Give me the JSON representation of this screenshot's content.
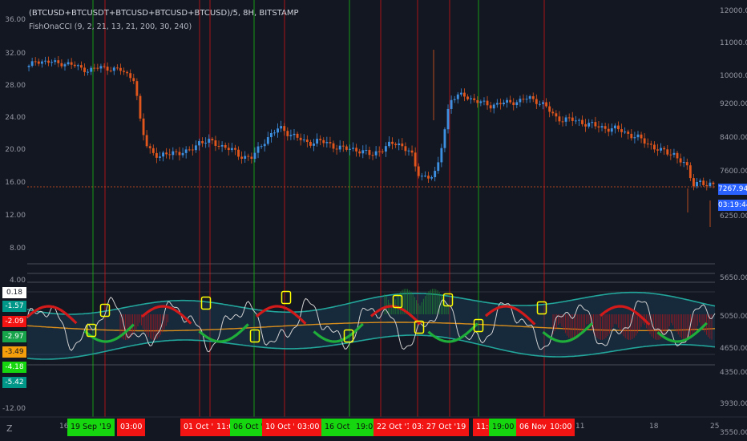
{
  "header": {
    "title": "(BTCUSD+BTCUSDT+BTCUSD+BTCUSD+BTCUSD)/5, 8H, BITSTAMP",
    "indicator": "FishOnaCCI (9, 2, 21, 13, 21, 200, 30, 240)"
  },
  "left_axis": [
    "36.00",
    "32.00",
    "28.00",
    "24.00",
    "20.00",
    "16.00",
    "12.00",
    "8.00",
    "4.00",
    "-12.00"
  ],
  "right_axis": [
    "12000.00",
    "11000.00",
    "10000.00",
    "9200.00",
    "8400.00",
    "7600.00",
    "6250.00",
    "5650.00",
    "5050.00",
    "4650.00",
    "4350.00",
    "3930.00",
    "3550.00"
  ],
  "price_badges": {
    "last": "7267.94",
    "timer": "03:19:44"
  },
  "indicator_badges": [
    {
      "text": "0.18",
      "bg": "#ffffff",
      "fg": "#131722"
    },
    {
      "text": "-1.57",
      "bg": "#009688",
      "fg": "#ffffff"
    },
    {
      "text": "-2.09",
      "bg": "#f21313",
      "fg": "#ffffff"
    },
    {
      "text": "-2.97",
      "bg": "#16a34a",
      "fg": "#ffffff"
    },
    {
      "text": "-3.49",
      "bg": "#f59e0b",
      "fg": "#131722"
    },
    {
      "text": "-4.18",
      "bg": "#16d70f",
      "fg": "#ffffff"
    },
    {
      "text": "-5.42",
      "bg": "#009688",
      "fg": "#ffffff"
    }
  ],
  "x_tags": [
    {
      "text": "19 Sep '19",
      "type": "g"
    },
    {
      "text": "03:00",
      "type": "r"
    },
    {
      "text": "01 Oct '19",
      "type": "r"
    },
    {
      "text": "11:00",
      "type": "r"
    },
    {
      "text": "06 Oct '19",
      "type": "g"
    },
    {
      "text": "10 Oct '19",
      "type": "r"
    },
    {
      "text": "03:00",
      "type": "r"
    },
    {
      "text": "16 Oct '19",
      "type": "g"
    },
    {
      "text": "19:00",
      "type": "g"
    },
    {
      "text": "22 Oct '19",
      "type": "r"
    },
    {
      "text": "03:00",
      "type": "r"
    },
    {
      "text": "27 Oct '19",
      "type": "r"
    },
    {
      "text": "11:00",
      "type": "r"
    },
    {
      "text": "19:00",
      "type": "g"
    },
    {
      "text": "06 Nov '19",
      "type": "r"
    },
    {
      "text": "10:00",
      "type": "r"
    }
  ],
  "x_ticks": [
    "16",
    "11",
    "18",
    "25"
  ],
  "icons": {
    "zoom": "Z"
  },
  "colors": {
    "background": "#131722",
    "bull": "#3d8fe0",
    "bear": "#e0561c",
    "buy_line": "#16d70f",
    "sell_line": "#f21313",
    "fish": "#d0d0d0",
    "band": "#22a59a",
    "signal": "#d98e1c"
  },
  "chart_data": {
    "type": "candlestick",
    "symbol": "(BTCUSD+BTCUSDT+BTCUSD+BTCUSD+BTCUSD)/5",
    "timeframe": "8H",
    "exchange": "BITSTAMP",
    "price_axis": {
      "min": 3550,
      "max": 12000,
      "ticks": [
        12000,
        11000,
        10000,
        9200,
        8400,
        7600,
        6250,
        5650,
        5050,
        4650,
        4350,
        3930,
        3550
      ]
    },
    "last_price": 7267.94,
    "price_path": [
      [
        0,
        10300
      ],
      [
        1,
        10500
      ],
      [
        3,
        10450
      ],
      [
        6,
        10400
      ],
      [
        9,
        10200
      ],
      [
        11,
        10300
      ],
      [
        14,
        10200
      ],
      [
        16,
        9950
      ],
      [
        17,
        8700
      ],
      [
        18,
        8200
      ],
      [
        20,
        7950
      ],
      [
        22,
        8100
      ],
      [
        24,
        8050
      ],
      [
        26,
        8350
      ],
      [
        28,
        8300
      ],
      [
        30,
        8200
      ],
      [
        32,
        8000
      ],
      [
        34,
        7950
      ],
      [
        36,
        8400
      ],
      [
        38,
        8650
      ],
      [
        40,
        8500
      ],
      [
        42,
        8300
      ],
      [
        44,
        8350
      ],
      [
        46,
        8250
      ],
      [
        48,
        8150
      ],
      [
        50,
        8150
      ],
      [
        52,
        8000
      ],
      [
        54,
        8200
      ],
      [
        56,
        8300
      ],
      [
        58,
        8100
      ],
      [
        59,
        7550
      ],
      [
        61,
        7450
      ],
      [
        62,
        7600
      ],
      [
        63,
        8500
      ],
      [
        64,
        9350
      ],
      [
        66,
        9500
      ],
      [
        68,
        9300
      ],
      [
        70,
        9200
      ],
      [
        72,
        9250
      ],
      [
        74,
        9300
      ],
      [
        76,
        9400
      ],
      [
        78,
        9250
      ],
      [
        80,
        8900
      ],
      [
        82,
        8850
      ],
      [
        84,
        8800
      ],
      [
        86,
        8700
      ],
      [
        88,
        8650
      ],
      [
        90,
        8600
      ],
      [
        92,
        8450
      ],
      [
        94,
        8300
      ],
      [
        96,
        8100
      ],
      [
        98,
        8050
      ],
      [
        100,
        7700
      ],
      [
        101,
        7250
      ],
      [
        102,
        7350
      ],
      [
        103,
        7150
      ],
      [
        104,
        7267.94
      ]
    ],
    "buy_dates": [
      "19 Sep '19 19:00",
      "06 Oct '19 11:00",
      "16 Oct '19 19:00",
      "27 Oct '19 11:00"
    ],
    "sell_dates": [
      "19 Sep '19 03:00",
      "01 Oct '19 11:00",
      "10 Oct '19 03:00",
      "22 Oct '19 03:00",
      "06 Nov '19 10:00"
    ],
    "indicator": {
      "name": "FishOnaCCI",
      "params": [
        9,
        2,
        21,
        13,
        21,
        200,
        30,
        240
      ],
      "axis": {
        "min": -12,
        "max": 36,
        "ticks": [
          36,
          32,
          28,
          24,
          20,
          16,
          12,
          8,
          4,
          -12
        ]
      },
      "last_values": {
        "fish": 0.18,
        "upper_band": -1.57,
        "fast": -2.09,
        "slow": -2.97,
        "signal": -3.49,
        "trigger": -4.18,
        "lower_band": -5.42
      }
    }
  }
}
